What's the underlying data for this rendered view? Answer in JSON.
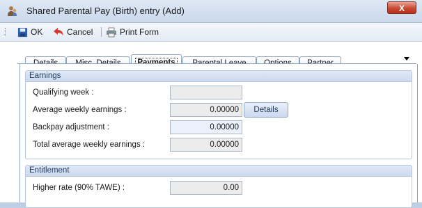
{
  "window": {
    "title": "Shared Parental Pay (Birth) entry (Add)",
    "close_label": "X"
  },
  "toolbar": {
    "ok_label": "OK",
    "cancel_label": "Cancel",
    "print_label": "Print Form"
  },
  "tabs": [
    {
      "label": "Details"
    },
    {
      "label": "Misc. Details"
    },
    {
      "label": "Payments"
    },
    {
      "label": "Parental Leave"
    },
    {
      "label": "Options"
    },
    {
      "label": "Partner"
    }
  ],
  "active_tab": "Payments",
  "earnings": {
    "heading": "Earnings",
    "qualifying_week_label": "Qualifying week :",
    "qualifying_week_value": "",
    "average_weekly_label": "Average weekly earnings :",
    "average_weekly_value": "0.00000",
    "details_button": "Details",
    "backpay_label": "Backpay adjustment :",
    "backpay_value": "0.00000",
    "total_average_label": "Total average weekly earnings :",
    "total_average_value": "0.00000"
  },
  "entitlement": {
    "heading": "Entitlement",
    "higher_rate_label": "Higher rate (90% TAWE) :",
    "higher_rate_value": "0.00"
  },
  "colors": {
    "title_bar": "#dfe9f5",
    "group_header": "#cbdaee",
    "close_button": "#c84a35",
    "accent_text": "#1e395b"
  }
}
